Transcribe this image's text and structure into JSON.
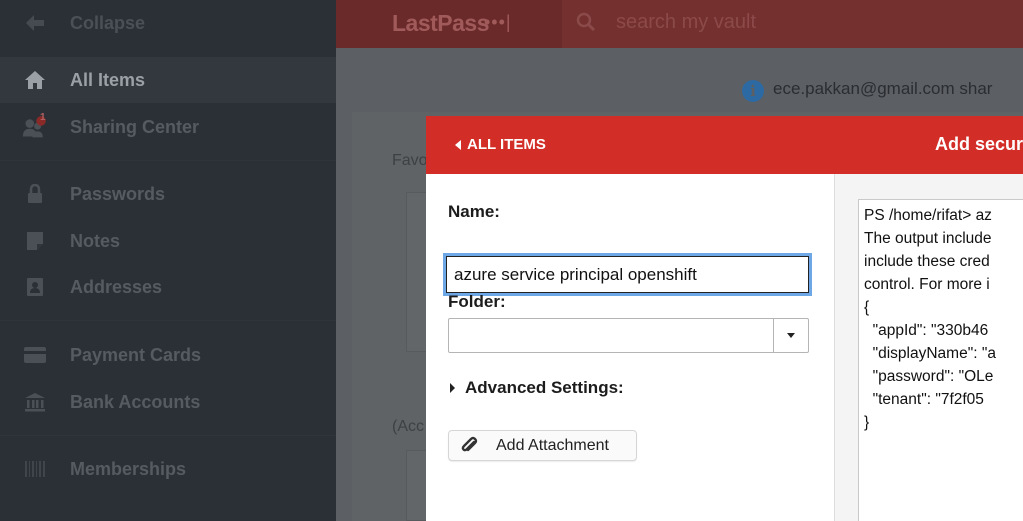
{
  "sidebar": {
    "collapse_label": "Collapse",
    "items": [
      {
        "label": "All Items",
        "icon": "home-icon"
      },
      {
        "label": "Sharing Center",
        "icon": "sharing-icon",
        "badge": "1"
      },
      {
        "label": "Passwords",
        "icon": "lock-icon"
      },
      {
        "label": "Notes",
        "icon": "note-icon"
      },
      {
        "label": "Addresses",
        "icon": "address-icon"
      },
      {
        "label": "Payment Cards",
        "icon": "card-icon"
      },
      {
        "label": "Bank Accounts",
        "icon": "bank-icon"
      },
      {
        "label": "Memberships",
        "icon": "barcode-icon"
      }
    ]
  },
  "header": {
    "logo_text": "LastPass",
    "logo_suffix": "•••|",
    "search_placeholder": "search my vault"
  },
  "main": {
    "share_notice": "ece.pakkan@gmail.com shar",
    "favorites_label": "Favo",
    "accounts_label": "(Acc"
  },
  "dialog": {
    "back_label": "ALL ITEMS",
    "title": "Add secur",
    "name_label": "Name:",
    "name_value": "azure service principal openshift",
    "folder_label": "Folder:",
    "folder_value": "",
    "advanced_label": "Advanced Settings:",
    "attach_label": "Add Attachment",
    "notes_lines": [
      "PS /home/rifat> az",
      "The output include",
      "include these cred",
      "control. For more i",
      "{",
      "  \"appId\": \"330b46",
      "  \"displayName\": \"a",
      "  \"password\": \"OLe",
      "  \"tenant\": \"7f2f05",
      "}"
    ]
  },
  "colors": {
    "accent": "#d32d27",
    "sidebar": "#2b3036",
    "focus": "#6ea7e6"
  }
}
